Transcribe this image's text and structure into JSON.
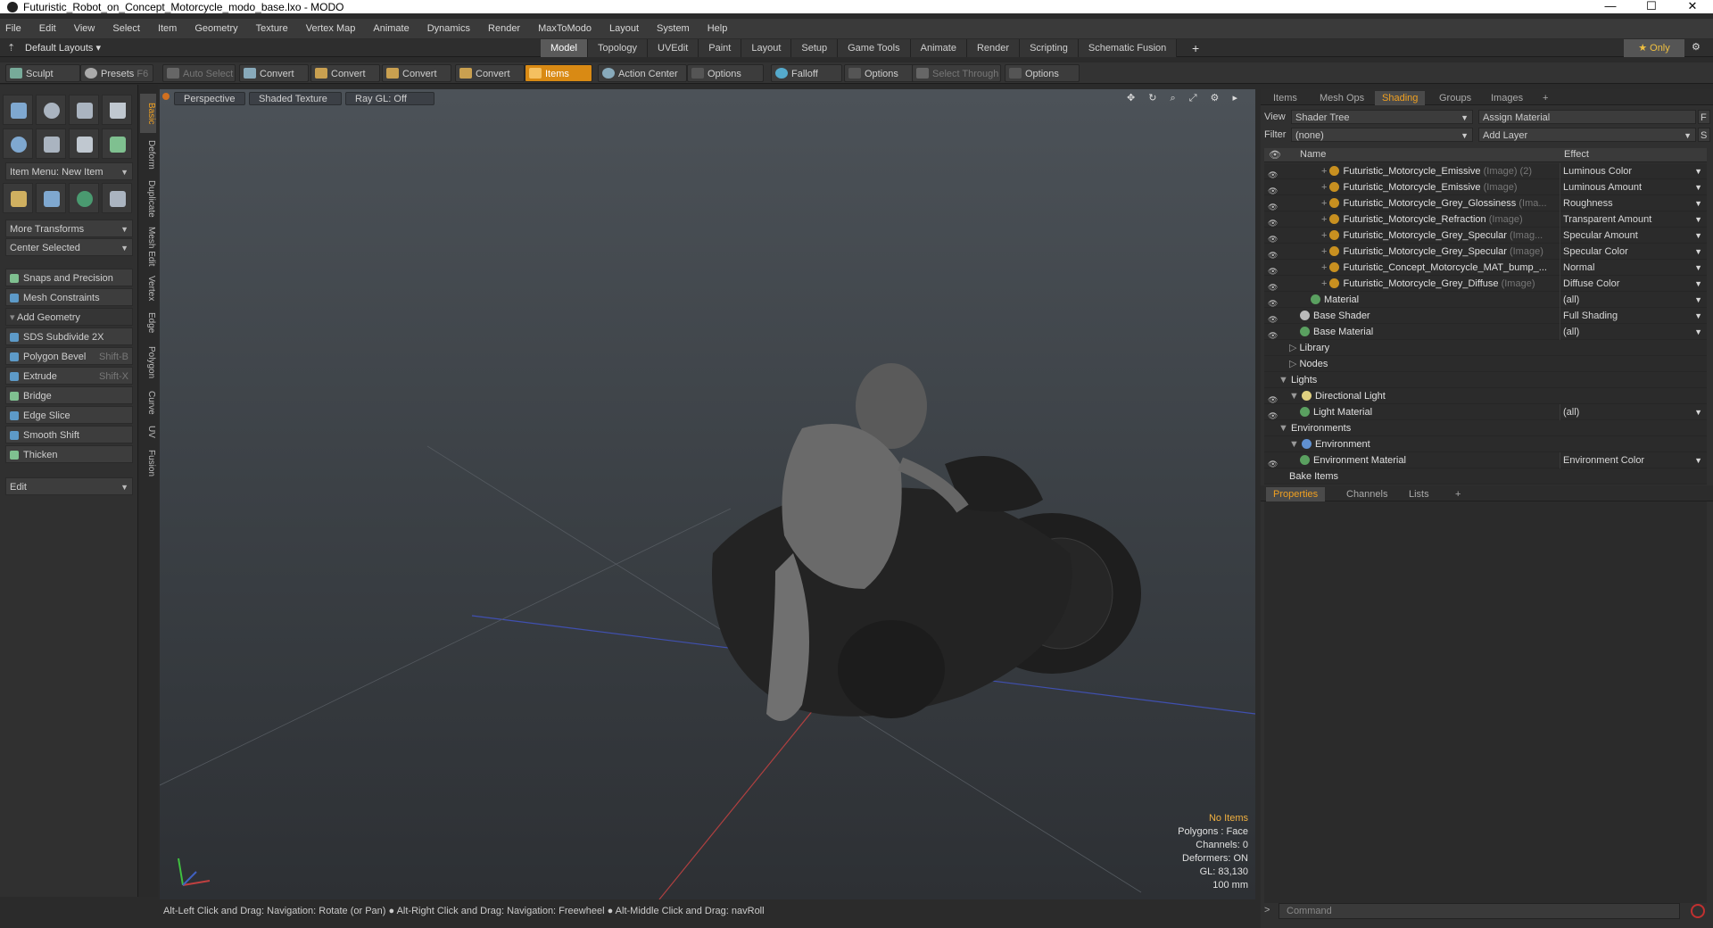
{
  "window": {
    "title": "Futuristic_Robot_on_Concept_Motorcycle_modo_base.lxo - MODO",
    "minimize": "—",
    "maximize": "☐",
    "close": "✕"
  },
  "menu": [
    "File",
    "Edit",
    "View",
    "Select",
    "Item",
    "Geometry",
    "Texture",
    "Vertex Map",
    "Animate",
    "Dynamics",
    "Render",
    "MaxToModo",
    "Layout",
    "System",
    "Help"
  ],
  "layout": {
    "default": "Default Layouts ▾",
    "tabs": [
      "Model",
      "Topology",
      "UVEdit",
      "Paint",
      "Layout",
      "Setup",
      "Game Tools",
      "Animate",
      "Render",
      "Scripting",
      "Schematic Fusion"
    ],
    "active": "Model",
    "plus": "+",
    "only": "★ Only"
  },
  "toolbar": {
    "sculpt": "Sculpt",
    "presets": "Presets",
    "presets_key": "F6",
    "auto_select": "Auto Select",
    "convert1": "Convert",
    "convert2": "Convert",
    "convert3": "Convert",
    "convert4": "Convert",
    "items": "Items",
    "action_center": "Action Center",
    "options1": "Options",
    "falloff": "Falloff",
    "options2": "Options",
    "select_through": "Select Through",
    "options3": "Options"
  },
  "left": {
    "item_menu": "Item Menu: New Item",
    "more_transforms": "More Transforms",
    "center_selected": "Center Selected",
    "snaps": "Snaps and Precision",
    "mesh_constraints": "Mesh Constraints",
    "add_geometry": "Add Geometry",
    "sds": "SDS Subdivide 2X",
    "polygon_bevel": "Polygon Bevel",
    "polygon_bevel_key": "Shift-B",
    "extrude": "Extrude",
    "extrude_key": "Shift-X",
    "bridge": "Bridge",
    "edge_slice": "Edge Slice",
    "smooth_shift": "Smooth Shift",
    "thicken": "Thicken",
    "edit": "Edit"
  },
  "vtabs": [
    "Basic",
    "Deform",
    "Duplicate",
    "Mesh Edit",
    "Vertex",
    "Edge",
    "Polygon",
    "Curve",
    "UV",
    "Fusion"
  ],
  "viewport": {
    "perspective": "Perspective",
    "shaded": "Shaded Texture",
    "raygl": "Ray GL: Off",
    "icons": "✥ ↻ ⌕ ⤢ ⚙ ▸",
    "stats": {
      "no_items": "No Items",
      "polygons": "Polygons : Face",
      "channels": "Channels: 0",
      "deformers": "Deformers: ON",
      "gl": "GL: 83,130",
      "size": "100 mm"
    }
  },
  "status": "Alt-Left Click and Drag: Navigation: Rotate (or Pan) ● Alt-Right Click and Drag: Navigation: Freewheel ● Alt-Middle Click and Drag: navRoll",
  "right": {
    "tabs": [
      "Items",
      "Mesh Ops",
      "Shading",
      "Groups",
      "Images",
      "+"
    ],
    "active_tab": "Shading",
    "view_label": "View",
    "view_value": "Shader Tree",
    "assign": "Assign Material",
    "f_btn": "F",
    "filter_label": "Filter",
    "filter_value": "(none)",
    "add_layer": "Add Layer",
    "s_btn": "S",
    "col_name": "Name",
    "col_effect": "Effect",
    "tree": [
      {
        "name": "Futuristic_Motorcycle_Emissive",
        "sub": "(Image) (2)",
        "effect": "Luminous Color",
        "eye": true,
        "ball": "#c89020",
        "expander": "+"
      },
      {
        "name": "Futuristic_Motorcycle_Emissive",
        "sub": "(Image)",
        "effect": "Luminous Amount",
        "eye": true,
        "ball": "#c89020",
        "expander": "+"
      },
      {
        "name": "Futuristic_Motorcycle_Grey_Glossiness",
        "sub": "(Ima...",
        "effect": "Roughness",
        "eye": true,
        "ball": "#c89020",
        "expander": "+"
      },
      {
        "name": "Futuristic_Motorcycle_Refraction",
        "sub": "(Image)",
        "effect": "Transparent Amount",
        "eye": true,
        "ball": "#c89020",
        "expander": "+"
      },
      {
        "name": "Futuristic_Motorcycle_Grey_Specular",
        "sub": "(Imag...",
        "effect": "Specular Amount",
        "eye": true,
        "ball": "#c89020",
        "expander": "+"
      },
      {
        "name": "Futuristic_Motorcycle_Grey_Specular",
        "sub": "(Image)",
        "effect": "Specular Color",
        "eye": true,
        "ball": "#c89020",
        "expander": "+"
      },
      {
        "name": "Futuristic_Concept_Motorcycle_MAT_bump_...",
        "sub": "",
        "effect": "Normal",
        "eye": true,
        "ball": "#c89020",
        "expander": "+"
      },
      {
        "name": "Futuristic_Motorcycle_Grey_Diffuse",
        "sub": "(Image)",
        "effect": "Diffuse Color",
        "eye": true,
        "ball": "#c89020",
        "expander": "+"
      },
      {
        "name": "Material",
        "sub": "",
        "effect": "(all)",
        "eye": true,
        "ball": "#5aa060",
        "expander": ""
      },
      {
        "name": "Base Shader",
        "sub": "",
        "effect": "Full Shading",
        "eye": true,
        "ball": "#bbbbbb",
        "expander": ""
      },
      {
        "name": "Base Material",
        "sub": "",
        "effect": "(all)",
        "eye": true,
        "ball": "#5aa060",
        "expander": ""
      },
      {
        "name": "Library",
        "sub": "",
        "effect": "",
        "eye": false,
        "ball": "",
        "expander": "▷"
      },
      {
        "name": "Nodes",
        "sub": "",
        "effect": "",
        "eye": false,
        "ball": "",
        "expander": "▷"
      },
      {
        "name": "Lights",
        "sub": "",
        "effect": "",
        "eye": false,
        "ball": "",
        "expander": "▼"
      },
      {
        "name": "Directional Light",
        "sub": "",
        "effect": "",
        "eye": true,
        "ball": "#e0d080",
        "expander": "▼"
      },
      {
        "name": "Light Material",
        "sub": "",
        "effect": "(all)",
        "eye": true,
        "ball": "#5aa060",
        "expander": ""
      },
      {
        "name": "Environments",
        "sub": "",
        "effect": "",
        "eye": false,
        "ball": "",
        "expander": "▼"
      },
      {
        "name": "Environment",
        "sub": "",
        "effect": "",
        "eye": false,
        "ball": "#6090d0",
        "expander": "▼"
      },
      {
        "name": "Environment Material",
        "sub": "",
        "effect": "Environment Color",
        "eye": true,
        "ball": "#5aa060",
        "expander": ""
      },
      {
        "name": "Bake Items",
        "sub": "",
        "effect": "",
        "eye": false,
        "ball": "",
        "expander": ""
      }
    ],
    "prop_tabs": [
      "Properties",
      "Channels",
      "Lists",
      "+"
    ],
    "active_prop": "Properties",
    "command_placeholder": "Command"
  }
}
